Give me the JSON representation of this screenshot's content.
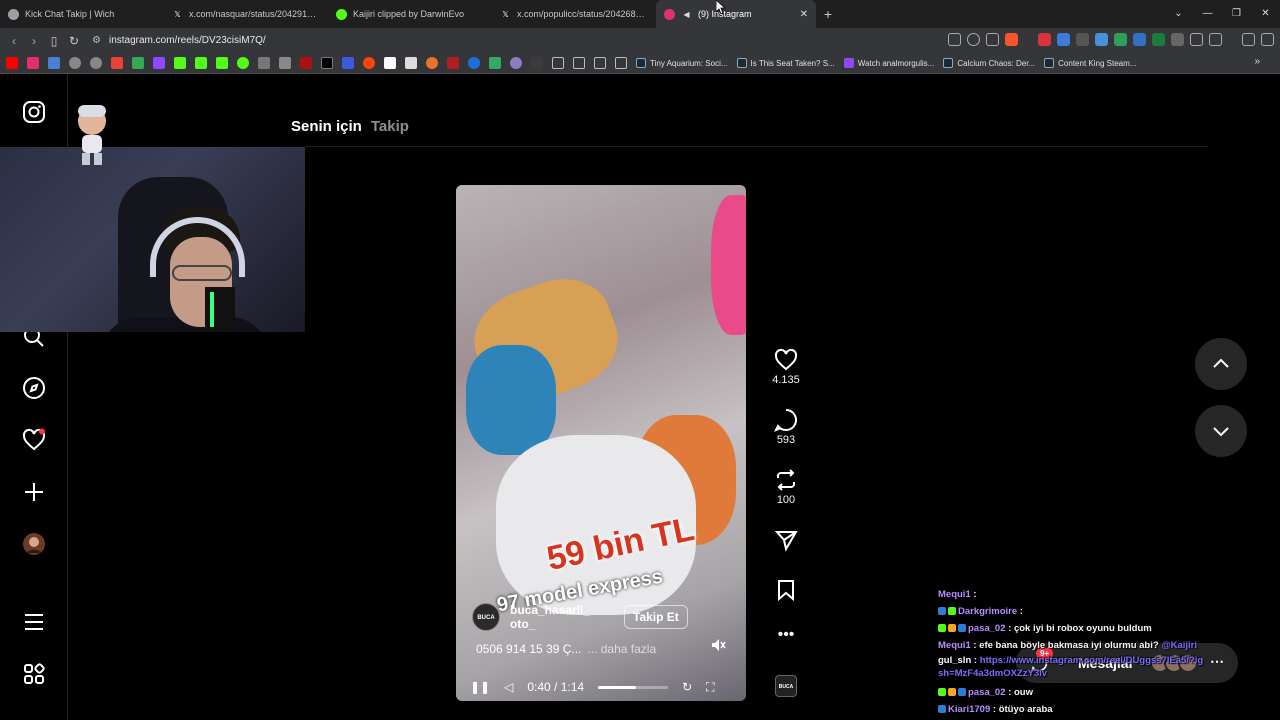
{
  "browser": {
    "tabs": [
      {
        "label": "Kick Chat Takip | Wich",
        "icon": "globe-icon",
        "color": "#9aa0a6",
        "active": false
      },
      {
        "label": "x.com/nasquar/status/204291570284",
        "icon": "x-icon",
        "color": "#ffffff",
        "active": false
      },
      {
        "label": "Kaijiri clipped by DarwinEvo",
        "icon": "kick-icon",
        "color": "#53fc18",
        "active": false
      },
      {
        "label": "x.com/populicc/status/20426820178",
        "icon": "x-icon",
        "color": "#ffffff",
        "active": false
      },
      {
        "label": "(9) Instagram",
        "icon": "instagram-icon",
        "color": "#e1306c",
        "active": true
      }
    ],
    "url": "instagram.com/reels/DV23cisiM7Q/",
    "bookmarks": [
      {
        "label": "Tiny Aquarium: Soci...",
        "icon": "steam-icon"
      },
      {
        "label": "Is This Seat Taken? S...",
        "icon": "steam-icon"
      },
      {
        "label": "Watch analmorgulis...",
        "icon": "twitch-icon"
      },
      {
        "label": "Calcium Chaos: Der...",
        "icon": "steam-icon"
      },
      {
        "label": "Content King Steam...",
        "icon": "steam-icon"
      }
    ]
  },
  "feed": {
    "tab_for_you": "Senin için",
    "tab_following": "Takip"
  },
  "reel": {
    "caption_price": "59 bin TL",
    "caption_model": "97 model express",
    "username": "buca_hasarli_ oto_",
    "avatar_text": "BUCA",
    "follow_label": "Takip Et",
    "description": "0506 914 15 39 Ç...",
    "more_label": "... daha fazla",
    "time": "0:40 / 1:14",
    "progress": 0.54,
    "likes": "4.135",
    "comments": "593",
    "reposts": "100"
  },
  "messages": {
    "label": "Mesajlar",
    "badge": "9+"
  },
  "chat": [
    {
      "user": "Mequi1",
      "text": ":",
      "color": "#b98cff"
    },
    {
      "user": "Darkgrimoire",
      "text": ":",
      "color": "#b98cff"
    },
    {
      "user": "pasa_02",
      "text": ": çok iyi bi robox oyunu buldum",
      "color": "#b98cff"
    },
    {
      "user": "Mequi1",
      "text": ": efe bana böyle bakmasa iyi olurmu abi?",
      "mention": "@Kaijiri",
      "color": "#b98cff"
    },
    {
      "user": "gul_sln",
      "text": ":",
      "link": "https://www.instagram.com/reel/DUggss7IEa5/?igsh=MzF4a3dmOXZzY3lv",
      "color": "#ffffff"
    },
    {
      "user": "pasa_02",
      "text": ": ouw",
      "color": "#b98cff"
    },
    {
      "user": "Kiari1709",
      "text": ": ötüyo araba",
      "color": "#b98cff"
    }
  ]
}
